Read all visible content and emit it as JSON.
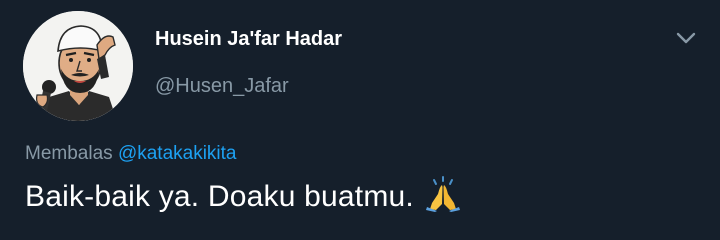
{
  "tweet": {
    "display_name": "Husein Ja'far Hadar",
    "handle": "@Husen_Jafar",
    "reply_prefix": "Membalas",
    "reply_mention": "@katakakikita",
    "text": "Baik-baik ya. Doaku buatmu.",
    "emoji": "folded-hands-emoji"
  },
  "icons": {
    "menu": "chevron-down-icon"
  },
  "colors": {
    "background": "#151f2b",
    "primary_text": "#ffffff",
    "secondary_text": "#8899a6",
    "link": "#1da1f2"
  }
}
